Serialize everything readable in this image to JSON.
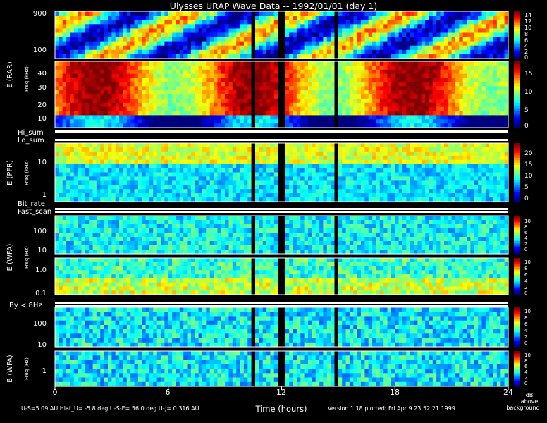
{
  "chart_data": {
    "type": "heatmap",
    "title": "Ulysses URAP Wave Data -- 1992/01/01  (day 1)",
    "xlabel": "Time (hours)",
    "x_ticks": [
      "0",
      "6",
      "12",
      "18",
      "24"
    ],
    "xlim": [
      0,
      24
    ],
    "unit_label": [
      "dB",
      "above",
      "background"
    ],
    "footer": {
      "left": "U-S=5.09 AU   Hlat_U= -5.8 deg   U-S-E= 56.0 deg   U-J= 0.316 AU",
      "right": "Version 1.18 plotted: Fri Apr  9 23:52:21 1999"
    },
    "colormap": [
      "#00007f",
      "#0000ff",
      "#007fff",
      "#00ffff",
      "#7fff7f",
      "#ffff00",
      "#ff7f00",
      "#ff0000",
      "#7f0000"
    ],
    "data_gaps_hours": [
      [
        10.5,
        10.62
      ],
      [
        11.85,
        12.2
      ],
      [
        14.75,
        14.95
      ]
    ],
    "instruments": [
      {
        "ylabel_outer": "E (RAR)",
        "ylabel_inner": "Freq (kHz)",
        "panels": [
          {
            "scale": "log",
            "ylim": [
              60,
              1000
            ],
            "y_ticks": [
              "900",
              "100"
            ],
            "cbar_ticks": [
              "14",
              "12",
              "10",
              "8",
              "6",
              "4",
              "2",
              "0"
            ],
            "cbar_max": 14
          },
          {
            "scale": "linear",
            "ylim": [
              0,
              50
            ],
            "y_ticks": [
              "40",
              "30",
              "20",
              "10"
            ],
            "cbar_ticks": [
              "15",
              "10",
              "5",
              "0"
            ],
            "cbar_max": 15
          }
        ],
        "status_labels": [
          "Hi_sum",
          "Lo_sum"
        ]
      },
      {
        "ylabel_outer": "E (PFR)",
        "ylabel_inner": "Freq (kHz)",
        "panels": [
          {
            "scale": "log",
            "ylim": [
              0.6,
              30
            ],
            "y_ticks": [
              "10",
              "1"
            ],
            "cbar_ticks": [
              "20",
              "15",
              "10",
              "5",
              "0"
            ],
            "cbar_max": 20
          }
        ],
        "status_labels": [
          "Bit_rate",
          "Fast_scan"
        ]
      },
      {
        "ylabel_outer": "E (WFA)",
        "ylabel_inner": "Freq (Hz)",
        "panels": [
          {
            "scale": "log",
            "ylim": [
              8,
              500
            ],
            "y_ticks": [
              "100",
              "10"
            ],
            "cbar_ticks": [
              "10",
              "8",
              "6",
              "4",
              "2",
              "0"
            ],
            "cbar_max": 10
          },
          {
            "scale": "log",
            "ylim": [
              0.07,
              5
            ],
            "y_ticks": [
              "1.0",
              "0.1"
            ],
            "cbar_ticks": [
              "10",
              "8",
              "6",
              "4",
              "2",
              "0"
            ],
            "cbar_max": 10
          }
        ],
        "status_labels": [
          "By < 8Hz"
        ]
      },
      {
        "ylabel_outer": "B (WFA)",
        "ylabel_inner": "Freq (Hz)",
        "panels": [
          {
            "scale": "log",
            "ylim": [
              8,
              500
            ],
            "y_ticks": [
              "100",
              "10"
            ],
            "cbar_ticks": [
              "10",
              "8",
              "6",
              "4",
              "2",
              "0"
            ],
            "cbar_max": 10
          },
          {
            "scale": "log",
            "ylim": [
              0.2,
              5
            ],
            "y_ticks": [
              "1"
            ],
            "cbar_ticks": [
              "10",
              "8",
              "6",
              "4",
              "2",
              "0"
            ],
            "cbar_max": 10
          }
        ],
        "status_labels": []
      }
    ]
  }
}
